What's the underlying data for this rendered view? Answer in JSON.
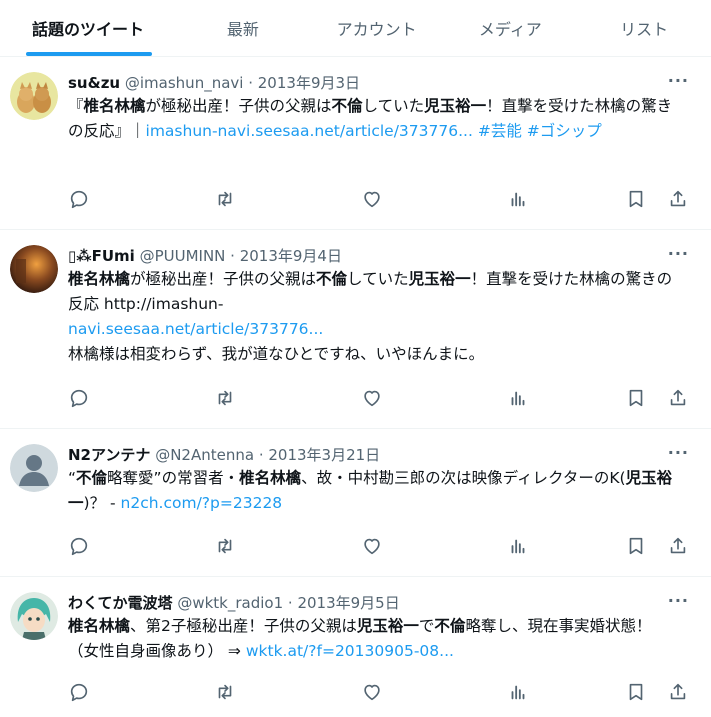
{
  "tabs": [
    {
      "label": "話題のツイート",
      "active": true
    },
    {
      "label": "最新"
    },
    {
      "label": "アカウント"
    },
    {
      "label": "メディア"
    },
    {
      "label": "リスト"
    }
  ],
  "tweets": [
    {
      "name": "su&zu",
      "handle": "@imashun_navi",
      "date": "2013年9月3日",
      "body": "『<b>椎名林檎</b>が極秘出産！子供の父親は<b>不倫</b>していた<b>児玉裕一</b>！直撃を受けた林檎の驚きの反応』｜<span class=\"link\">imashun-navi.seesaa.net/article/373776...</span> <span class=\"link\">#芸能</span> <span class=\"link\">#ゴシップ</span>"
    },
    {
      "name": "▯⁂FUmi",
      "handle": "@PUUMINN",
      "date": "2013年9月4日",
      "body": "<b>椎名林檎</b>が極秘出産！子供の父親は<b>不倫</b>していた<b>児玉裕一</b>！直撃を受けた林檎の驚きの反応 http://imashun-<br><span class=\"link\">navi.seesaa.net/article/373776...</span><br>林檎様は相変わらず、我が道なひとですね、いやほんまに。"
    },
    {
      "name": "N2アンテナ",
      "handle": "@N2Antenna",
      "date": "2013年3月21日",
      "body": "“<b>不倫</b>略奪愛”の常習者・<b>椎名林檎</b>、故・中村勘三郎の次は映像ディレクターのK(<b>児玉裕一</b>)？ - <span class=\"link\">n2ch.com/?p=23228</span>"
    },
    {
      "name": "わくてか電波塔",
      "handle": "@wktk_radio1",
      "date": "2013年9月5日",
      "body": "<b>椎名林檎</b>、第2子極秘出産！子供の父親は<b>児玉裕一</b>で<b>不倫</b>略奪し、現在事実婚状態！（女性自身画像あり） ⇒ <span class=\"link\">wktk.at/?f=20130905-08...</span>"
    }
  ],
  "icons": {
    "reply": "reply-icon",
    "retweet": "retweet-icon",
    "like": "like-icon",
    "views": "views-icon",
    "bookmark": "bookmark-icon",
    "share": "share-icon",
    "more": "more-icon"
  },
  "colors": {
    "accent": "#1d9bf0",
    "muted": "#536471",
    "text": "#0f1419"
  }
}
